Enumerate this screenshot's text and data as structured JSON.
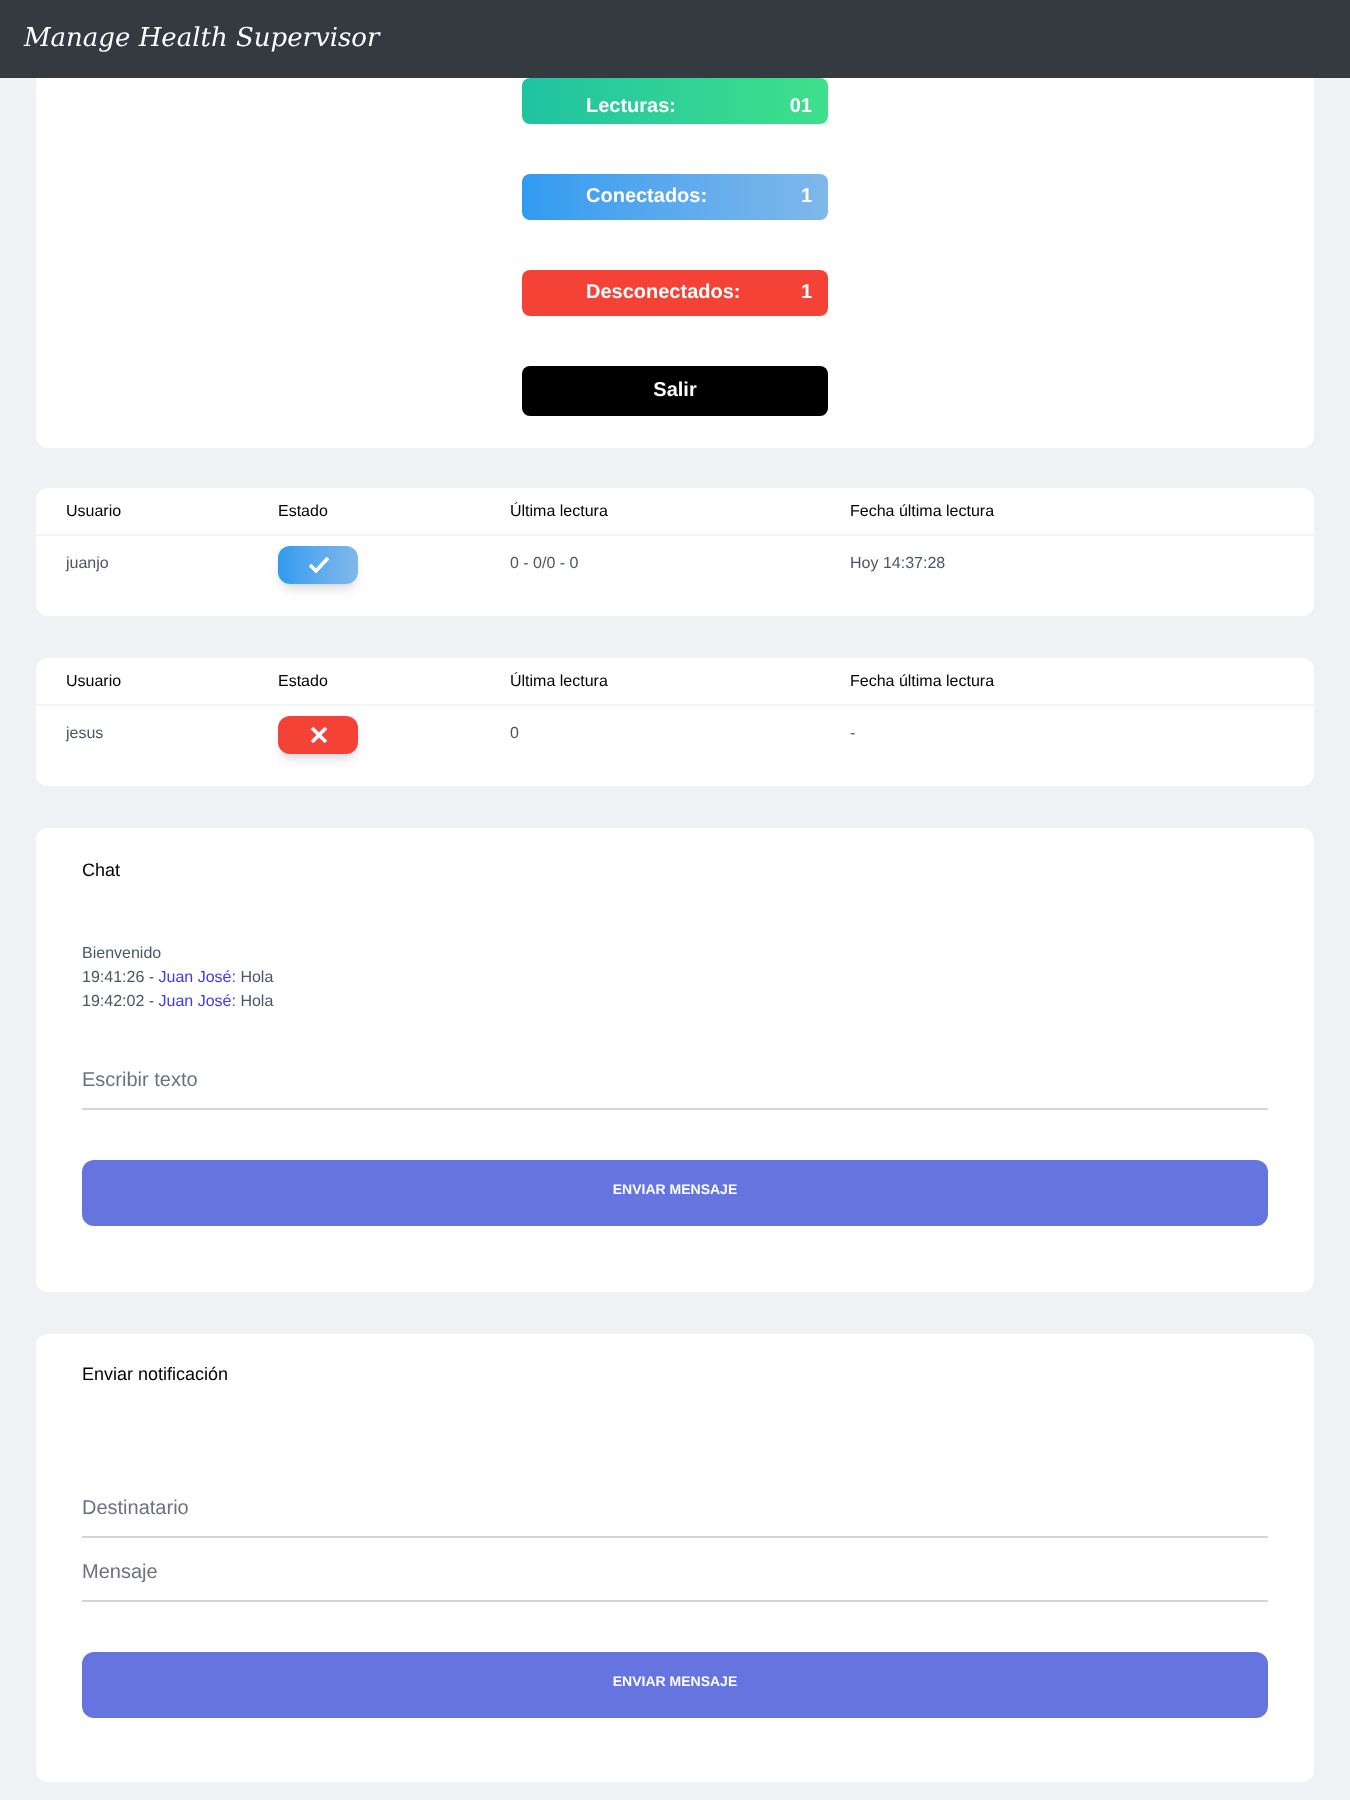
{
  "app_title": "Manage Health Supervisor",
  "stats": [
    {
      "kind": "readings",
      "label": "Lecturas:",
      "value": "01"
    },
    {
      "kind": "connected",
      "label": "Conectados:",
      "value": "1"
    },
    {
      "kind": "disconnected",
      "label": "Desconectados:",
      "value": "1"
    }
  ],
  "logout_button": "Salir",
  "user_tables": [
    {
      "columns": [
        "Usuario",
        "Estado",
        "Última lectura",
        "Fecha última lectura"
      ],
      "rows": [
        {
          "user": "juanjo",
          "connected": true,
          "last_reading": "0 - 0/0 - 0",
          "last_reading_date": "Hoy 14:37:28"
        }
      ]
    },
    {
      "columns": [
        "Usuario",
        "Estado",
        "Última lectura",
        "Fecha última lectura"
      ],
      "rows": [
        {
          "user": "jesus",
          "connected": false,
          "last_reading": "0",
          "last_reading_date": "-"
        }
      ]
    }
  ],
  "chat": {
    "title": "Chat",
    "welcome": "Bienvenido",
    "messages": [
      {
        "time": "19:41:26 -",
        "author": "Juan José:",
        "text": "Hola"
      },
      {
        "time": "19:42:02 -",
        "author": "Juan José:",
        "text": "Hola"
      }
    ],
    "input": {
      "placeholder": "Escribir texto"
    },
    "send_button": "ENVIAR MENSAJE"
  },
  "notification": {
    "title": "Enviar notificación",
    "recipient": {
      "placeholder": "Destinatario"
    },
    "message": {
      "placeholder": "Mensaje"
    },
    "send_button": "ENVIAR MENSAJE"
  }
}
